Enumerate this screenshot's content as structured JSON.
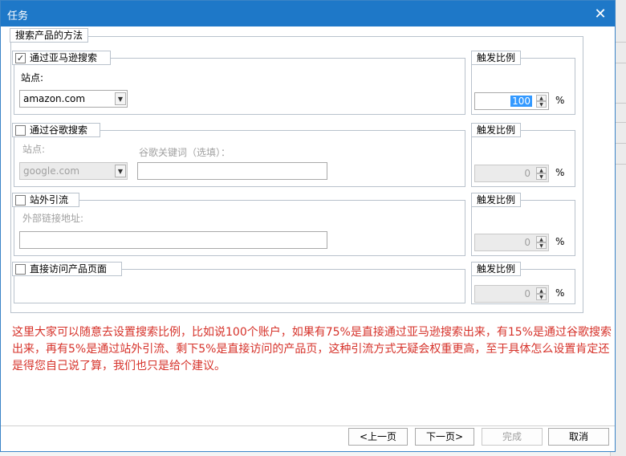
{
  "window": {
    "title": "任务",
    "close_glyph": "✕"
  },
  "group": {
    "title": "搜索产品的方法"
  },
  "sections": {
    "amazon": {
      "label": "通过亚马逊搜索",
      "checked": true,
      "check_glyph": "✓",
      "site_label": "站点:",
      "site_value": "amazon.com",
      "ratio_title": "触发比例",
      "ratio_value": "100",
      "ratio_unit": "%"
    },
    "google": {
      "label": "通过谷歌搜索",
      "checked": false,
      "site_label": "站点:",
      "site_value": "google.com",
      "keyword_label": "谷歌关键词（选填）：",
      "keyword_value": "",
      "ratio_title": "触发比例",
      "ratio_value": "0",
      "ratio_unit": "%"
    },
    "external": {
      "label": "站外引流",
      "checked": false,
      "link_label": "外部链接地址:",
      "link_value": "",
      "ratio_title": "触发比例",
      "ratio_value": "0",
      "ratio_unit": "%"
    },
    "direct": {
      "label": "直接访问产品页面",
      "checked": false,
      "ratio_title": "触发比例",
      "ratio_value": "0",
      "ratio_unit": "%"
    }
  },
  "note": "这里大家可以随意去设置搜索比例，比如说100个账户，如果有75%是直接通过亚马逊搜索出来，有15%是通过谷歌搜索出来，再有5%是通过站外引流、剩下5%是直接访问的产品页，这种引流方式无疑会权重更高，至于具体怎么设置肯定还是得您自己说了算，我们也只是给个建议。",
  "buttons": {
    "prev": "<上一页",
    "next": "下一页>",
    "finish": "完成",
    "cancel": "取消"
  },
  "icons": {
    "dropdown": "▼",
    "spin_up": "▲",
    "spin_down": "▼"
  },
  "colors": {
    "titlebar": "#1e78c8",
    "note_text": "#d6322a",
    "selection": "#3399ff"
  }
}
